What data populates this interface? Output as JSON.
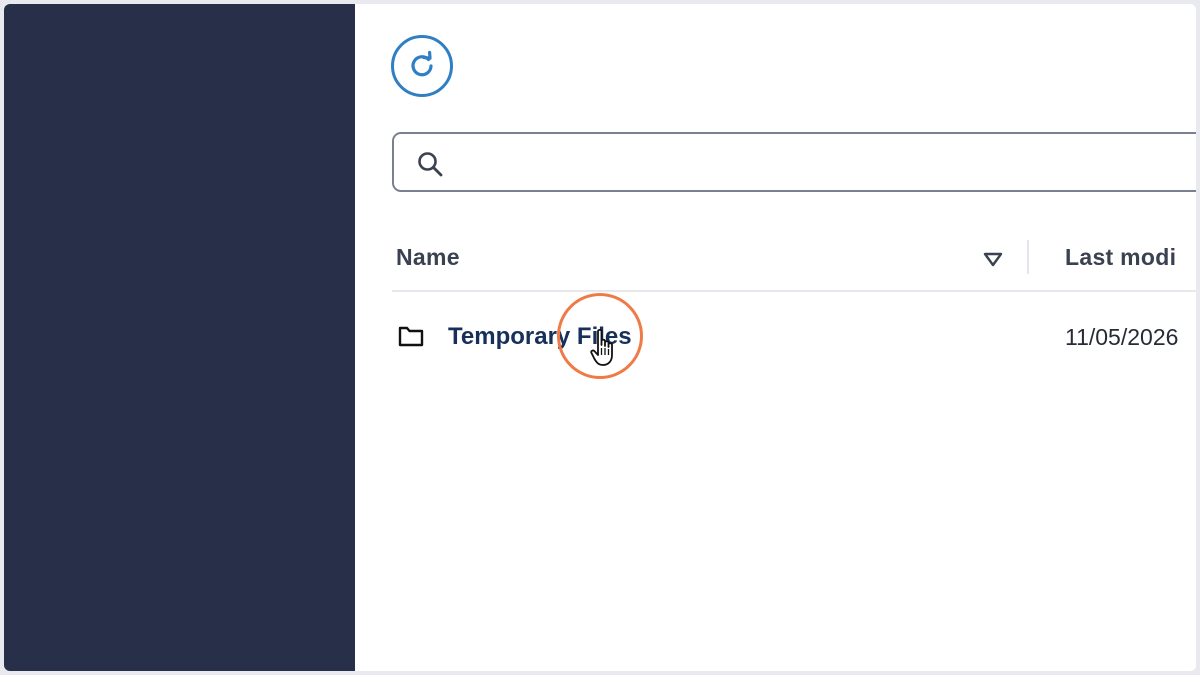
{
  "toolbar": {
    "refresh_icon": "refresh-icon"
  },
  "search": {
    "icon": "search-icon",
    "value": "",
    "placeholder": ""
  },
  "table": {
    "columns": [
      {
        "label": "Name",
        "sort_icon": "sort-down-triangle-icon"
      },
      {
        "label": "Last modi"
      }
    ],
    "rows": [
      {
        "icon": "folder-icon",
        "name": "Temporary Files",
        "modified": "11/05/2026"
      }
    ]
  },
  "colors": {
    "sidebar": "#282f48",
    "accent": "#2f7fc4",
    "link": "#16305a",
    "highlight": "#f07a45"
  }
}
